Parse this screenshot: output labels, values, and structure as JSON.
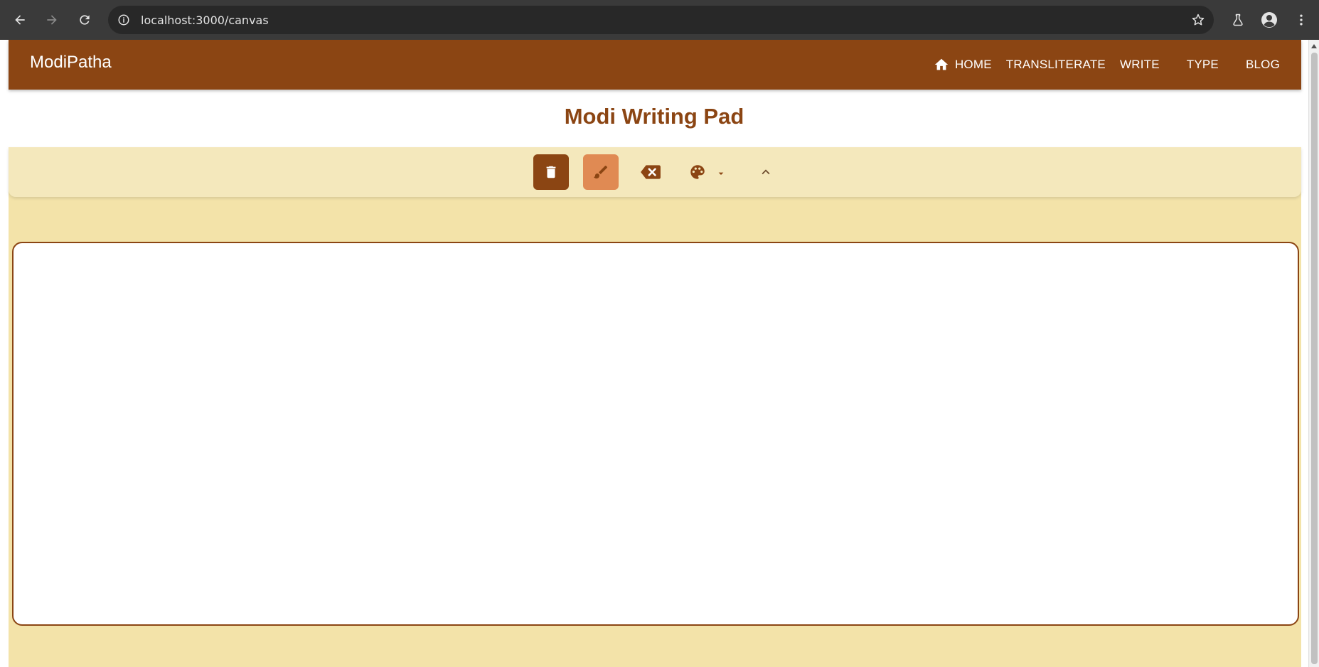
{
  "browser": {
    "url": "localhost:3000/canvas",
    "icons": {
      "back": "arrow-left-icon",
      "forward": "arrow-right-icon",
      "reload": "reload-icon",
      "site_info": "info-icon",
      "bookmark": "star-icon",
      "labs": "flask-icon",
      "profile": "account-circle-icon",
      "menu": "kebab-menu-icon"
    }
  },
  "navbar": {
    "brand": "ModiPatha",
    "links": [
      {
        "label": "HOME",
        "icon": "home-icon"
      },
      {
        "label": "TRANSLITERATE"
      },
      {
        "label": "WRITE"
      },
      {
        "label": "TYPE"
      },
      {
        "label": "BLOG"
      }
    ]
  },
  "main": {
    "title": "Modi Writing Pad",
    "toolbar": {
      "tools": [
        {
          "icon": "trash-icon",
          "state": "active-dark"
        },
        {
          "icon": "brush-icon",
          "state": "selected"
        },
        {
          "icon": "backspace-eraser-icon"
        },
        {
          "icon": "palette-icon",
          "has_dropdown": true
        },
        {
          "icon": "chevron-up-icon"
        }
      ]
    }
  },
  "colors": {
    "primary": "#8b4513",
    "accent": "#e08a53",
    "toolbar_bg": "#f4e8bc",
    "work_bg": "#f3e3a9",
    "browser_bg": "#3a3a3a"
  }
}
